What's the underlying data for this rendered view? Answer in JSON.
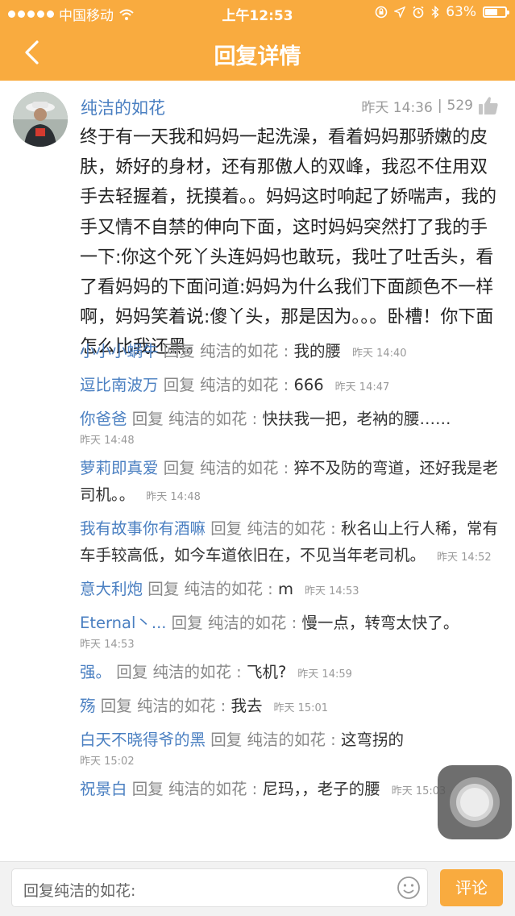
{
  "statusbar": {
    "carrier": "中国移动",
    "time": "上午12:53",
    "battery": "63%",
    "battery_level": 0.63
  },
  "navbar": {
    "title": "回复详情"
  },
  "post": {
    "author": "纯洁的如花",
    "time": "昨天 14:36",
    "separator": "|",
    "likes": "529",
    "body": "终于有一天我和妈妈一起洗澡，看着妈妈那骄嫩的皮肤，娇好的身材，还有那傲人的双峰，我忍不住用双手去轻握着，抚摸着。。妈妈这时响起了娇喘声，我的手又情不自禁的伸向下面，这时妈妈突然打了我的手一下:你这个死丫头连妈妈也敢玩，我吐了吐舌头，看了看妈妈的下面问道:妈妈为什么我们下面颜色不一样啊，妈妈笑着说:傻丫头，那是因为。。。卧槽！你下面怎么比我还黑。"
  },
  "replies": [
    {
      "name": "小小小蜗牛",
      "reply_word": "回复",
      "target": "纯洁的如花",
      "colon": ":",
      "text": "我的腰",
      "time": "昨天 14:40"
    },
    {
      "name": "逗比南波万",
      "reply_word": "回复",
      "target": "纯洁的如花",
      "colon": ":",
      "text": "666",
      "time": "昨天 14:47"
    },
    {
      "name": "你爸爸",
      "reply_word": "回复",
      "target": "纯洁的如花",
      "colon": ":",
      "text": "快扶我一把，老衲的腰……",
      "time": "昨天 14:48"
    },
    {
      "name": "萝莉即真爱",
      "reply_word": "回复",
      "target": "纯洁的如花",
      "colon": ":",
      "text": "猝不及防的弯道，还好我是老司机。。",
      "time": "昨天 14:48"
    },
    {
      "name": "我有故事你有酒嘛",
      "reply_word": "回复",
      "target": "纯洁的如花",
      "colon": ":",
      "text": "秋名山上行人稀，常有车手较高低，如今车道依旧在，不见当年老司机。",
      "time": "昨天 14:52"
    },
    {
      "name": "意大利炮",
      "reply_word": "回复",
      "target": "纯洁的如花",
      "colon": ":",
      "text": "m",
      "time": "昨天 14:53"
    },
    {
      "name": "Eternal丶...",
      "reply_word": "回复",
      "target": "纯洁的如花",
      "colon": ":",
      "text": "慢一点，转弯太快了。",
      "time": "昨天 14:53"
    },
    {
      "name": "强。",
      "reply_word": "回复",
      "target": "纯洁的如花",
      "colon": ":",
      "text": "飞机?",
      "time": "昨天 14:59"
    },
    {
      "name": "殇",
      "reply_word": "回复",
      "target": "纯洁的如花",
      "colon": ":",
      "text": "我去",
      "time": "昨天 15:01"
    },
    {
      "name": "白天不晓得爷的黑",
      "reply_word": "回复",
      "target": "纯洁的如花",
      "colon": ":",
      "text": "这弯拐的",
      "time": "昨天 15:02"
    },
    {
      "name": "祝景白",
      "reply_word": "回复",
      "target": "纯洁的如花",
      "colon": ":",
      "text": "尼玛，，老子的腰",
      "time": "昨天 15:03"
    }
  ],
  "input": {
    "placeholder": "回复纯洁的如花:"
  },
  "send_label": "评论",
  "icons": {
    "back": "chevron-left-icon",
    "like": "thumbs-up-icon",
    "emoji": "smiley-icon",
    "assistive": "assistive-touch-icon"
  },
  "colors": {
    "accent": "#f9ab3f",
    "link": "#4a7fc1",
    "muted": "#999999"
  }
}
